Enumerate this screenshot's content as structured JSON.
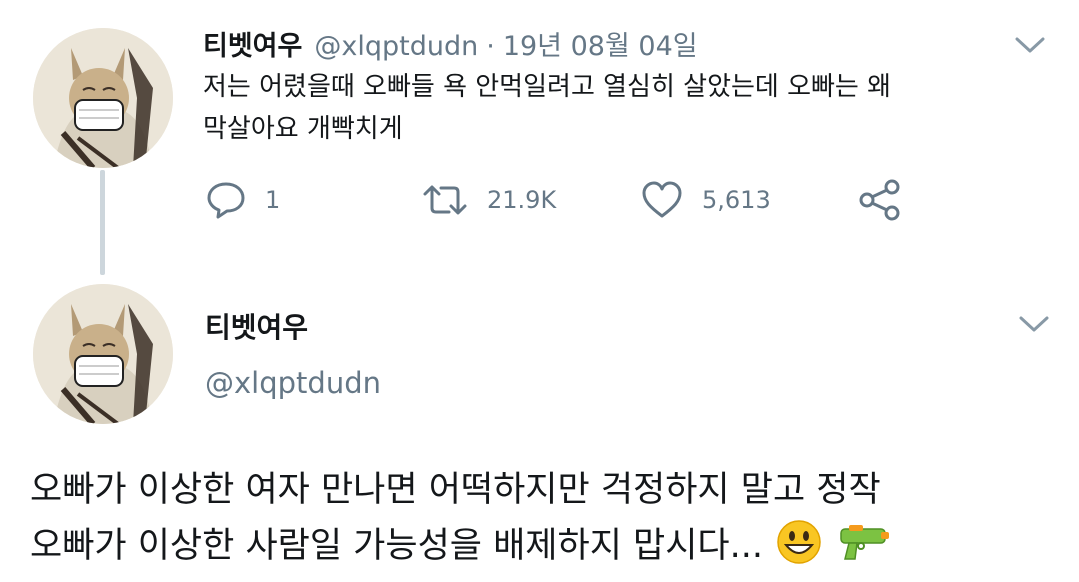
{
  "tweet": {
    "author_name": "티벳여우",
    "handle": "@xlqptdudn",
    "separator": "·",
    "date": "19년 08월 04일",
    "text_line1": "저는 어렸을때 오빠들 욕 안먹일려고 열심히 살았는데 오빠는 왜",
    "text_line2": "막살아요 개빡치게",
    "actions": {
      "reply_count": "1",
      "retweet_count": "21.9K",
      "like_count": "5,613"
    }
  },
  "reply": {
    "author_name": "티벳여우",
    "handle": "@xlqptdudn",
    "text_line1": "오빠가 이상한 여자 만나면 어떡하지만 걱정하지 말고 정작",
    "text_line2": "오빠가 이상한 사람일 가능성을 배제하지 맙시다...",
    "emojis": [
      "grinning-face-emoji",
      "water-pistol-emoji"
    ]
  },
  "icons": {
    "reply": "speech-bubble-icon",
    "retweet": "retweet-icon",
    "like": "heart-icon",
    "share": "share-icon",
    "menu": "chevron-down-icon"
  },
  "colors": {
    "text": "#14171a",
    "secondary": "#657786",
    "thread_line": "#cdd6dc",
    "icon": "#657786"
  }
}
